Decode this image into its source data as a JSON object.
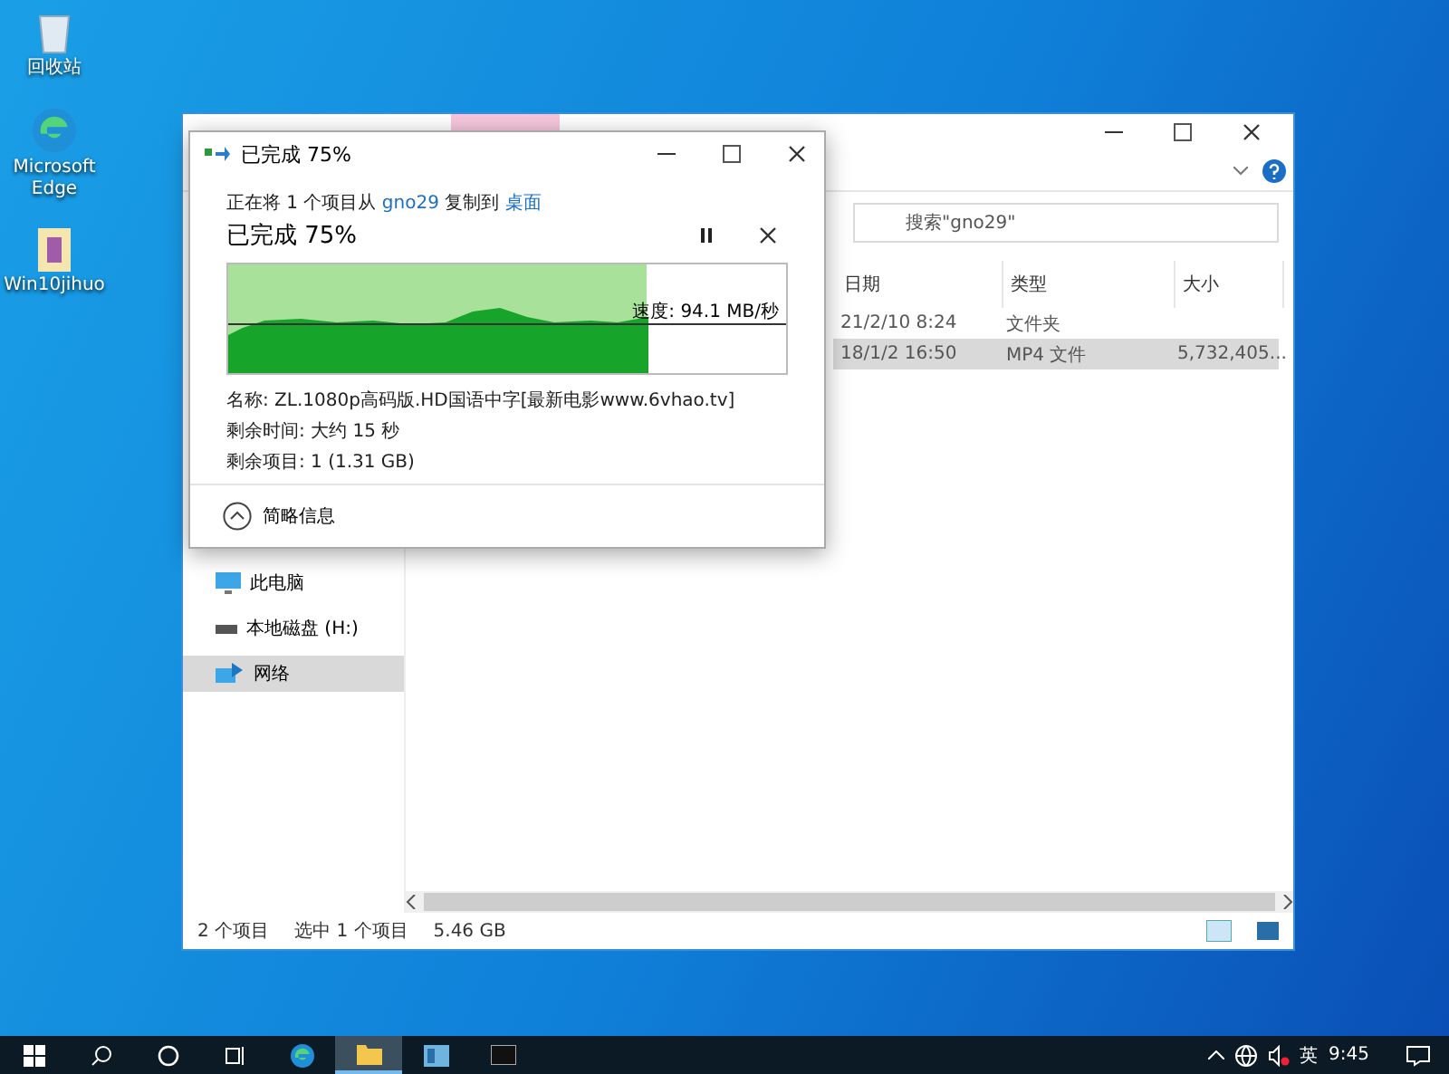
{
  "desktop_icons": [
    {
      "kind": "bin",
      "label": "回收站"
    },
    {
      "kind": "edge",
      "label": "Microsoft Edge"
    },
    {
      "kind": "file",
      "label": "Win10jihuo"
    }
  ],
  "explorer": {
    "search": {
      "placeholder": "搜索\"gno29\""
    },
    "columns": [
      "日期",
      "类型",
      "大小"
    ],
    "rows": [
      {
        "cells": [
          "21/2/10 8:24",
          "文件夹",
          ""
        ],
        "selected": false
      },
      {
        "cells": [
          "18/1/2 16:50",
          "MP4 文件",
          "5,732,405..."
        ],
        "selected": true
      }
    ],
    "sidebar": [
      {
        "kind": "pc",
        "label": "此电脑",
        "selected": false
      },
      {
        "kind": "disk",
        "label": "本地磁盘 (H:)",
        "selected": false
      },
      {
        "kind": "net",
        "label": "网络",
        "selected": true
      }
    ],
    "status": [
      "2 个项目",
      "选中 1 个项目",
      "5.46 GB"
    ]
  },
  "dialog": {
    "title": "已完成 75%",
    "from": {
      "before": "正在将 1 个项目从 ",
      "source": "gno29",
      "middle": " 复制到 ",
      "target": "桌面"
    },
    "heading": "已完成 75%",
    "progress": {
      "level": 0.75
    },
    "speed": "速度: 94.1 MB/秒",
    "details": [
      "名称: ZL.1080p高码版.HD国语中字[最新电影www.6vhao.tv]",
      "剩余时间: 大约 15 秒",
      "剩余项目: 1 (1.31 GB)"
    ],
    "toggle": "简略信息"
  },
  "taskbar": {
    "apps": [
      {
        "kind": "edge",
        "active": false
      },
      {
        "kind": "folder",
        "active": true
      },
      {
        "kind": "app",
        "active": false
      },
      {
        "kind": "cmd",
        "active": false
      }
    ],
    "lang": "英",
    "time": "9:45"
  }
}
